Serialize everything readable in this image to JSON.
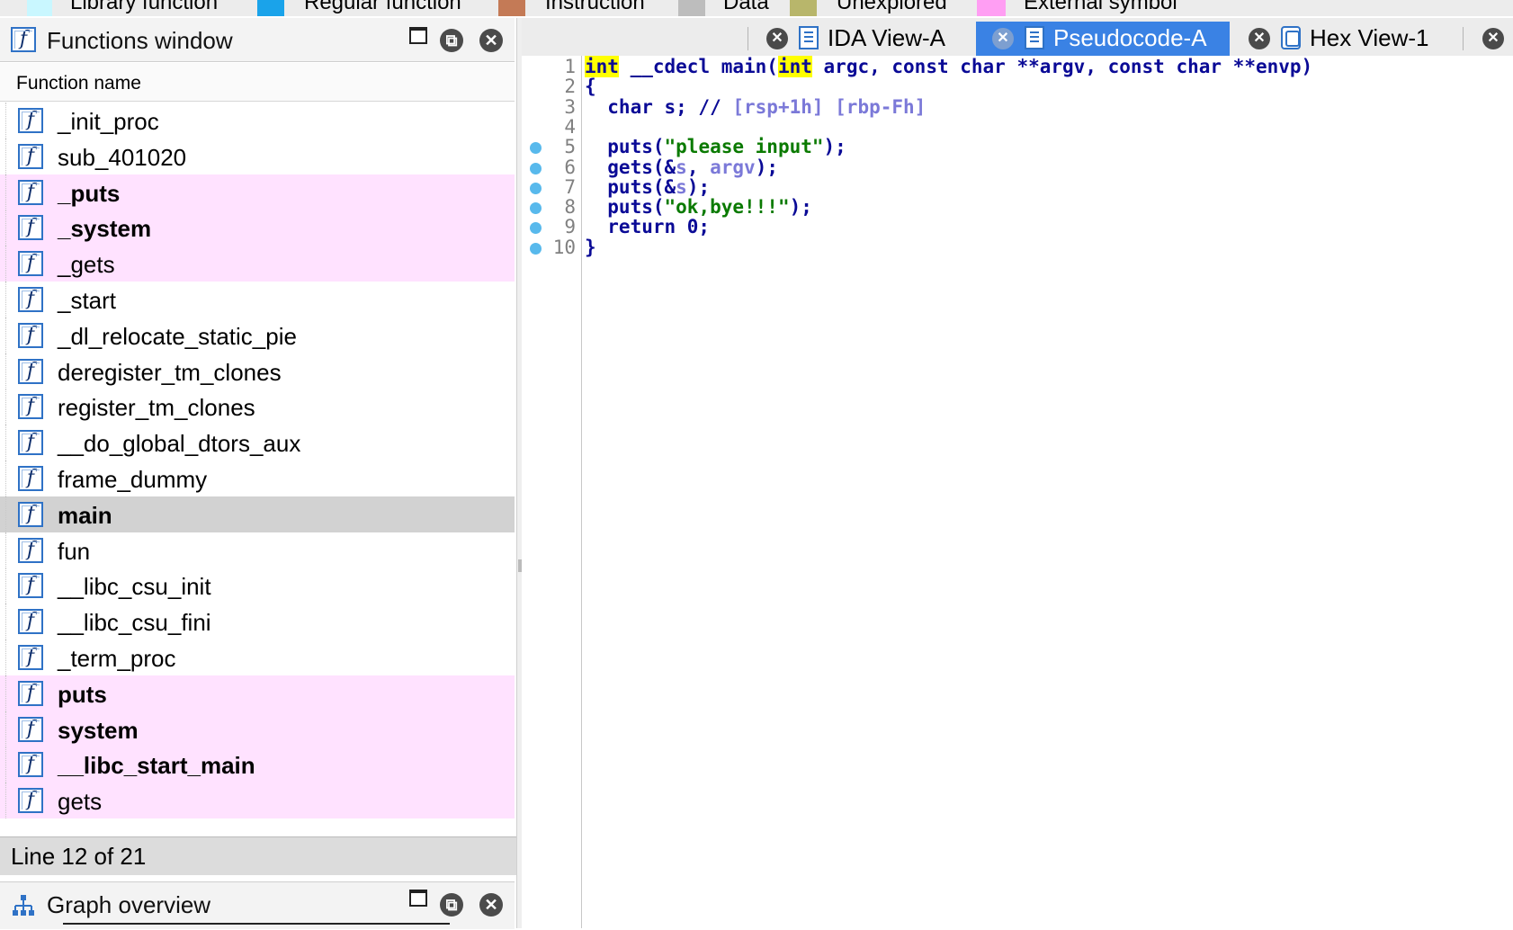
{
  "legend": [
    {
      "label": "Library function",
      "color": "#c9f7ff"
    },
    {
      "label": "Regular function",
      "color": "#1aa3ea"
    },
    {
      "label": "Instruction",
      "color": "#c47a56"
    },
    {
      "label": "Data",
      "color": "#bdbdbd"
    },
    {
      "label": "Unexplored",
      "color": "#b8b66b"
    },
    {
      "label": "External symbol",
      "color": "#ff9ef3"
    }
  ],
  "functions_window": {
    "title": "Functions window",
    "column_header": "Function name",
    "status": "Line 12 of 21",
    "items": [
      {
        "name": "_init_proc",
        "style": "normal"
      },
      {
        "name": "sub_401020",
        "style": "normal"
      },
      {
        "name": "_puts",
        "style": "ext-bold"
      },
      {
        "name": "_system",
        "style": "ext-bold"
      },
      {
        "name": "_gets",
        "style": "ext"
      },
      {
        "name": "_start",
        "style": "normal"
      },
      {
        "name": "_dl_relocate_static_pie",
        "style": "normal"
      },
      {
        "name": "deregister_tm_clones",
        "style": "normal"
      },
      {
        "name": "register_tm_clones",
        "style": "normal"
      },
      {
        "name": "__do_global_dtors_aux",
        "style": "normal"
      },
      {
        "name": "frame_dummy",
        "style": "normal"
      },
      {
        "name": "main",
        "style": "selected-bold"
      },
      {
        "name": "fun",
        "style": "normal"
      },
      {
        "name": "__libc_csu_init",
        "style": "normal"
      },
      {
        "name": "__libc_csu_fini",
        "style": "normal"
      },
      {
        "name": "_term_proc",
        "style": "normal"
      },
      {
        "name": "puts",
        "style": "ext-bold"
      },
      {
        "name": "system",
        "style": "ext-bold"
      },
      {
        "name": "__libc_start_main",
        "style": "ext-bold"
      },
      {
        "name": "gets",
        "style": "ext"
      }
    ]
  },
  "graph_overview": {
    "title": "Graph overview"
  },
  "tabs": [
    {
      "label": "IDA View-A",
      "icon": "listing-icon",
      "active": false
    },
    {
      "label": "Pseudocode-A",
      "icon": "pseudocode-icon",
      "active": true
    },
    {
      "label": "Hex View-1",
      "icon": "hex-icon",
      "active": false
    }
  ],
  "code": [
    {
      "n": "1",
      "bp": false,
      "segs": [
        [
          "int",
          "hl"
        ],
        [
          " __cdecl main(",
          ""
        ],
        [
          "int",
          "hl"
        ],
        [
          " argc, const char **argv, const char **envp)",
          ""
        ]
      ]
    },
    {
      "n": "2",
      "bp": false,
      "segs": [
        [
          "{",
          ""
        ]
      ]
    },
    {
      "n": "3",
      "bp": false,
      "segs": [
        [
          "  char s; // ",
          ""
        ],
        [
          "[rsp+1h] [rbp-Fh]",
          "cmt"
        ]
      ]
    },
    {
      "n": "4",
      "bp": false,
      "segs": []
    },
    {
      "n": "5",
      "bp": true,
      "segs": [
        [
          "  puts(",
          ""
        ],
        [
          "\"please input\"",
          "str"
        ],
        [
          ");",
          ""
        ]
      ]
    },
    {
      "n": "6",
      "bp": true,
      "segs": [
        [
          "  gets(&",
          ""
        ],
        [
          "s",
          "var"
        ],
        [
          ", ",
          ""
        ],
        [
          "argv",
          "var"
        ],
        [
          ");",
          ""
        ]
      ]
    },
    {
      "n": "7",
      "bp": true,
      "segs": [
        [
          "  puts(&",
          ""
        ],
        [
          "s",
          "var"
        ],
        [
          ");",
          ""
        ]
      ]
    },
    {
      "n": "8",
      "bp": true,
      "segs": [
        [
          "  puts(",
          ""
        ],
        [
          "\"ok,bye!!!\"",
          "str"
        ],
        [
          ");",
          ""
        ]
      ]
    },
    {
      "n": "9",
      "bp": true,
      "segs": [
        [
          "  return 0;",
          ""
        ]
      ]
    },
    {
      "n": "10",
      "bp": true,
      "segs": [
        [
          "}",
          ""
        ]
      ]
    }
  ]
}
